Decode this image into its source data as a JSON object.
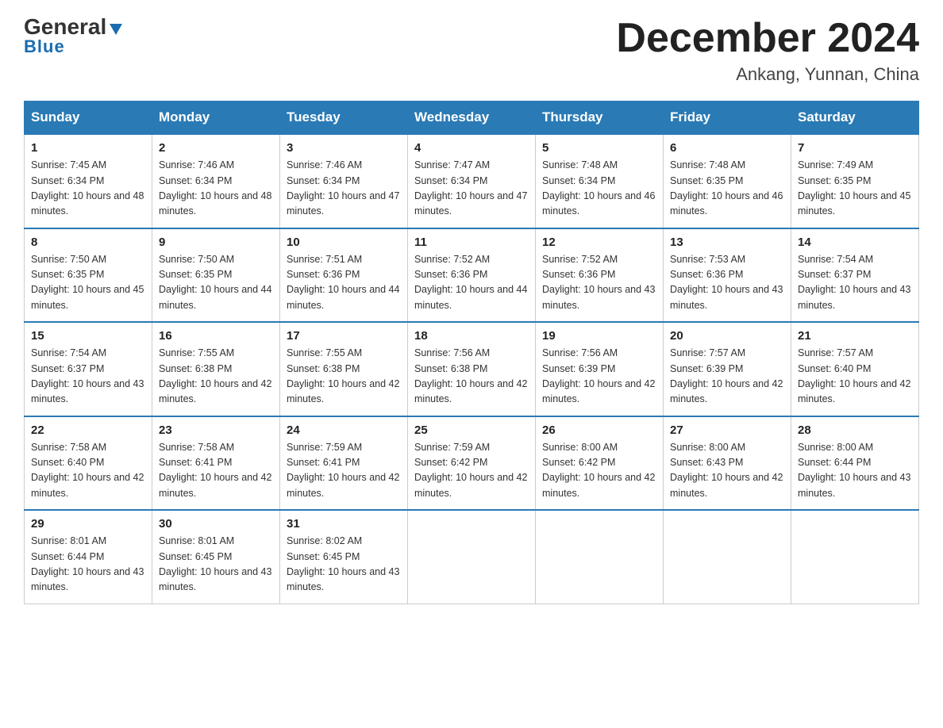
{
  "header": {
    "logo_general": "General",
    "logo_blue": "Blue",
    "month_title": "December 2024",
    "location": "Ankang, Yunnan, China"
  },
  "days_of_week": [
    "Sunday",
    "Monday",
    "Tuesday",
    "Wednesday",
    "Thursday",
    "Friday",
    "Saturday"
  ],
  "weeks": [
    [
      {
        "day": "1",
        "sunrise": "7:45 AM",
        "sunset": "6:34 PM",
        "daylight": "10 hours and 48 minutes."
      },
      {
        "day": "2",
        "sunrise": "7:46 AM",
        "sunset": "6:34 PM",
        "daylight": "10 hours and 48 minutes."
      },
      {
        "day": "3",
        "sunrise": "7:46 AM",
        "sunset": "6:34 PM",
        "daylight": "10 hours and 47 minutes."
      },
      {
        "day": "4",
        "sunrise": "7:47 AM",
        "sunset": "6:34 PM",
        "daylight": "10 hours and 47 minutes."
      },
      {
        "day": "5",
        "sunrise": "7:48 AM",
        "sunset": "6:34 PM",
        "daylight": "10 hours and 46 minutes."
      },
      {
        "day": "6",
        "sunrise": "7:48 AM",
        "sunset": "6:35 PM",
        "daylight": "10 hours and 46 minutes."
      },
      {
        "day": "7",
        "sunrise": "7:49 AM",
        "sunset": "6:35 PM",
        "daylight": "10 hours and 45 minutes."
      }
    ],
    [
      {
        "day": "8",
        "sunrise": "7:50 AM",
        "sunset": "6:35 PM",
        "daylight": "10 hours and 45 minutes."
      },
      {
        "day": "9",
        "sunrise": "7:50 AM",
        "sunset": "6:35 PM",
        "daylight": "10 hours and 44 minutes."
      },
      {
        "day": "10",
        "sunrise": "7:51 AM",
        "sunset": "6:36 PM",
        "daylight": "10 hours and 44 minutes."
      },
      {
        "day": "11",
        "sunrise": "7:52 AM",
        "sunset": "6:36 PM",
        "daylight": "10 hours and 44 minutes."
      },
      {
        "day": "12",
        "sunrise": "7:52 AM",
        "sunset": "6:36 PM",
        "daylight": "10 hours and 43 minutes."
      },
      {
        "day": "13",
        "sunrise": "7:53 AM",
        "sunset": "6:36 PM",
        "daylight": "10 hours and 43 minutes."
      },
      {
        "day": "14",
        "sunrise": "7:54 AM",
        "sunset": "6:37 PM",
        "daylight": "10 hours and 43 minutes."
      }
    ],
    [
      {
        "day": "15",
        "sunrise": "7:54 AM",
        "sunset": "6:37 PM",
        "daylight": "10 hours and 43 minutes."
      },
      {
        "day": "16",
        "sunrise": "7:55 AM",
        "sunset": "6:38 PM",
        "daylight": "10 hours and 42 minutes."
      },
      {
        "day": "17",
        "sunrise": "7:55 AM",
        "sunset": "6:38 PM",
        "daylight": "10 hours and 42 minutes."
      },
      {
        "day": "18",
        "sunrise": "7:56 AM",
        "sunset": "6:38 PM",
        "daylight": "10 hours and 42 minutes."
      },
      {
        "day": "19",
        "sunrise": "7:56 AM",
        "sunset": "6:39 PM",
        "daylight": "10 hours and 42 minutes."
      },
      {
        "day": "20",
        "sunrise": "7:57 AM",
        "sunset": "6:39 PM",
        "daylight": "10 hours and 42 minutes."
      },
      {
        "day": "21",
        "sunrise": "7:57 AM",
        "sunset": "6:40 PM",
        "daylight": "10 hours and 42 minutes."
      }
    ],
    [
      {
        "day": "22",
        "sunrise": "7:58 AM",
        "sunset": "6:40 PM",
        "daylight": "10 hours and 42 minutes."
      },
      {
        "day": "23",
        "sunrise": "7:58 AM",
        "sunset": "6:41 PM",
        "daylight": "10 hours and 42 minutes."
      },
      {
        "day": "24",
        "sunrise": "7:59 AM",
        "sunset": "6:41 PM",
        "daylight": "10 hours and 42 minutes."
      },
      {
        "day": "25",
        "sunrise": "7:59 AM",
        "sunset": "6:42 PM",
        "daylight": "10 hours and 42 minutes."
      },
      {
        "day": "26",
        "sunrise": "8:00 AM",
        "sunset": "6:42 PM",
        "daylight": "10 hours and 42 minutes."
      },
      {
        "day": "27",
        "sunrise": "8:00 AM",
        "sunset": "6:43 PM",
        "daylight": "10 hours and 42 minutes."
      },
      {
        "day": "28",
        "sunrise": "8:00 AM",
        "sunset": "6:44 PM",
        "daylight": "10 hours and 43 minutes."
      }
    ],
    [
      {
        "day": "29",
        "sunrise": "8:01 AM",
        "sunset": "6:44 PM",
        "daylight": "10 hours and 43 minutes."
      },
      {
        "day": "30",
        "sunrise": "8:01 AM",
        "sunset": "6:45 PM",
        "daylight": "10 hours and 43 minutes."
      },
      {
        "day": "31",
        "sunrise": "8:02 AM",
        "sunset": "6:45 PM",
        "daylight": "10 hours and 43 minutes."
      },
      null,
      null,
      null,
      null
    ]
  ]
}
